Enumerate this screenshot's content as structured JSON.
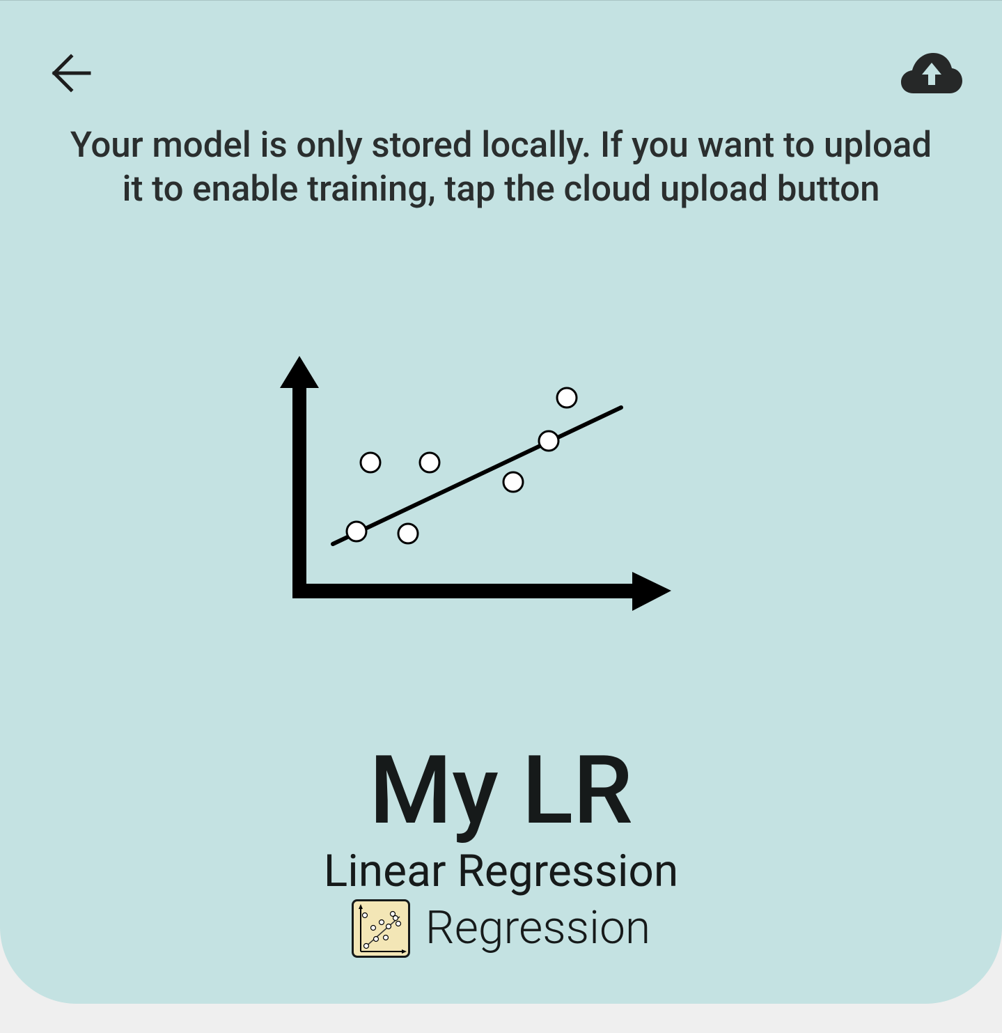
{
  "header": {
    "back_icon": "arrow-left-icon",
    "upload_icon": "cloud-upload-icon"
  },
  "notice": {
    "text": "Your model is only stored locally. If you want to upload it to enable training, tap the cloud upload button"
  },
  "illustration": {
    "icon": "scatter-plot-with-regression-line"
  },
  "model": {
    "name": "My LR",
    "type": "Linear Regression",
    "category": "Regression",
    "category_icon": "regression-chart-icon"
  },
  "colors": {
    "card_background": "#c4e2e2",
    "page_background": "#efefef",
    "text_primary": "#161a1a",
    "category_icon_fill": "#f3e6b6"
  }
}
